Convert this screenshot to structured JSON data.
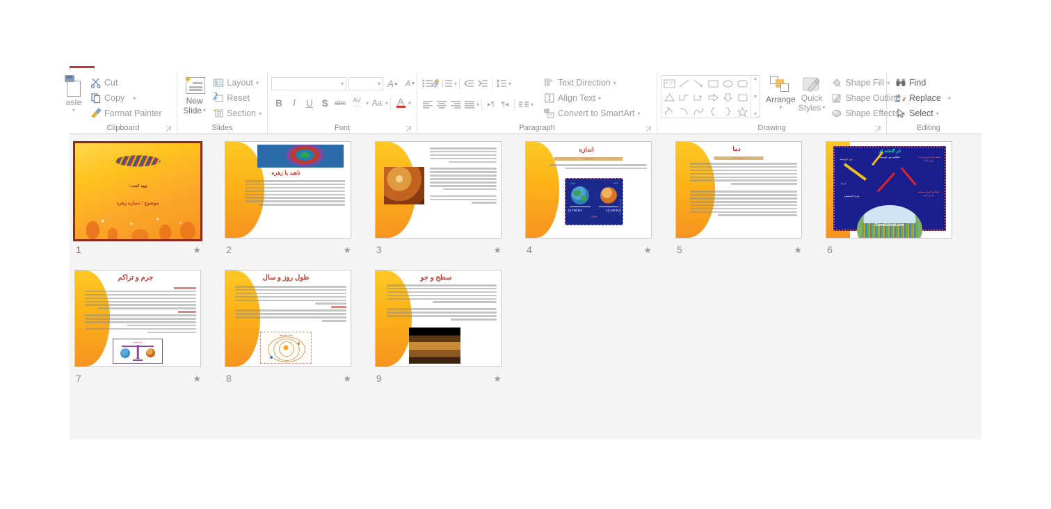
{
  "app": {
    "name": "PowerPoint",
    "view": "Slide Sorter"
  },
  "ribbon": {
    "groups": [
      {
        "name": "Clipboard",
        "label": "Clipboard",
        "paste_label": "aste",
        "items": [
          {
            "label": "Cut",
            "icon": "scissors-icon"
          },
          {
            "label": "Copy",
            "icon": "copy-icon",
            "caret": "▾"
          },
          {
            "label": "Format Painter",
            "icon": "format-painter-icon"
          }
        ]
      },
      {
        "name": "Slides",
        "label": "Slides",
        "new_slide_line1": "New",
        "new_slide_line2": "Slide",
        "items": [
          {
            "label": "Layout",
            "icon": "layout-icon",
            "caret": "▾"
          },
          {
            "label": "Reset",
            "icon": "reset-icon"
          },
          {
            "label": "Section",
            "icon": "section-icon",
            "caret": "▾"
          }
        ]
      },
      {
        "name": "Font",
        "label": "Font",
        "font_name_value": "",
        "font_size_value": "",
        "buttons": [
          {
            "label": "A",
            "name": "increase-font-size-button"
          },
          {
            "label": "A",
            "name": "decrease-font-size-button"
          },
          {
            "label": "",
            "name": "clear-formatting-button"
          },
          {
            "label": "B",
            "name": "bold-button"
          },
          {
            "label": "I",
            "name": "italic-button"
          },
          {
            "label": "U",
            "name": "underline-button"
          },
          {
            "label": "S",
            "name": "text-shadow-button"
          },
          {
            "label": "abc",
            "name": "strikethrough-button"
          },
          {
            "label": "AV",
            "name": "character-spacing-button"
          },
          {
            "label": "Aa",
            "name": "change-case-button"
          },
          {
            "label": "A",
            "name": "font-color-button"
          }
        ]
      },
      {
        "name": "Paragraph",
        "label": "Paragraph",
        "items": [
          {
            "label": "Text Direction",
            "icon": "text-direction-icon",
            "caret": "▾"
          },
          {
            "label": "Align Text",
            "icon": "align-text-icon",
            "caret": "▾"
          },
          {
            "label": "Convert to SmartArt",
            "icon": "smartart-icon",
            "caret": "▾"
          }
        ]
      },
      {
        "name": "Drawing",
        "label": "Drawing",
        "arrange_label": "Arrange",
        "quick_styles_line1": "Quick",
        "quick_styles_line2": "Styles",
        "items": [
          {
            "label": "Shape Fill",
            "icon": "shape-fill-icon",
            "caret": "▾"
          },
          {
            "label": "Shape Outline",
            "icon": "shape-outline-icon",
            "caret": "▾"
          },
          {
            "label": "Shape Effects",
            "icon": "shape-effects-icon",
            "caret": "▾"
          }
        ]
      },
      {
        "name": "Editing",
        "label": "Editing",
        "items": [
          {
            "label": "Find",
            "icon": "binoculars-icon"
          },
          {
            "label": "Replace",
            "icon": "replace-icon",
            "caret": "▾"
          },
          {
            "label": "Select",
            "icon": "select-pointer-icon",
            "caret": "▾"
          }
        ]
      }
    ]
  },
  "slides": [
    {
      "number": "1",
      "selected": true,
      "has_transition_star": true,
      "layout": "title",
      "title": "بسم الله الرحمن الرحیم",
      "subtitle1": "تهیه کننده :",
      "subtitle2": "موضوع : سیاره زهره"
    },
    {
      "number": "2",
      "selected": false,
      "has_transition_star": true,
      "layout": "image-top",
      "title": "ناهید یا زهره",
      "image": "venus-topographic-map"
    },
    {
      "number": "3",
      "selected": false,
      "has_transition_star": true,
      "layout": "image-left",
      "title": "",
      "image": "venus-globe"
    },
    {
      "number": "4",
      "selected": false,
      "has_transition_star": true,
      "layout": "title-image",
      "title": "اندازه",
      "image": "earth-venus-size-comparison",
      "image_labels": {
        "left_planet": "زمین",
        "right_planet": "ناهید",
        "left_value": "12,756 km",
        "right_value": "12,104 km",
        "watermark": "ZoomSchool.com"
      }
    },
    {
      "number": "5",
      "selected": false,
      "has_transition_star": true,
      "layout": "title-text",
      "title": "دما"
    },
    {
      "number": "6",
      "selected": false,
      "has_transition_star": false,
      "layout": "full-image",
      "title": "اثر گلخانه ای",
      "image": "greenhouse-effect-diagram",
      "image_labels": {
        "sunlight": "نور خورشید",
        "reflection": "انعکاس نور خورشید",
        "escaping": "اشعه های فروسرخ به سوی فضا",
        "clouds": "ابرها",
        "atmosphere": "جو (یا اتمسفر)",
        "trapped": "انعکاس گرما به سیاره باز می گردد",
        "watermark": "ZoomSchool.com"
      }
    },
    {
      "number": "7",
      "selected": false,
      "has_transition_star": true,
      "layout": "title-text-image",
      "title": "جرم و تراکم",
      "image": "balance-scale-earth-venus"
    },
    {
      "number": "8",
      "selected": false,
      "has_transition_star": true,
      "layout": "title-text-image",
      "title": "طول روز و سال",
      "image": "orbit-diagram"
    },
    {
      "number": "9",
      "selected": false,
      "has_transition_star": true,
      "layout": "title-text-image",
      "title": "سطح و جو",
      "image": "venus-surface-landscape"
    }
  ],
  "colors": {
    "selection_border": "#8e2a20",
    "selected_number": "#9e4b3e",
    "slide_title_red": "#c0392b",
    "accent_orange": "#f7931e",
    "accent_yellow": "#ffc21e",
    "ribbon_text_gray": "#9b9b9b",
    "sorter_background": "#f4f4f4",
    "tab_indicator": "#c0392b"
  },
  "icons": {
    "transition_star": "★",
    "caret_down": "▾",
    "dialog_launcher": "⌐"
  }
}
